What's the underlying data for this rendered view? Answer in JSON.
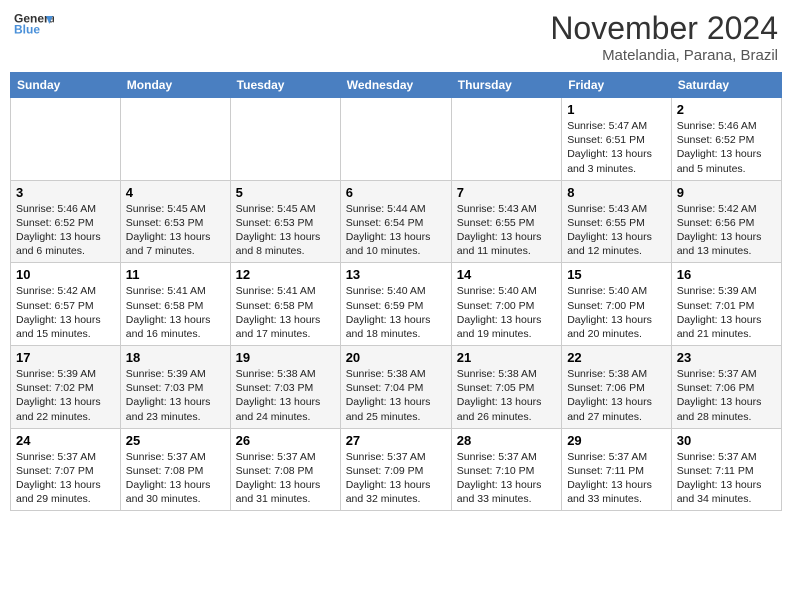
{
  "header": {
    "logo_line1": "General",
    "logo_line2": "Blue",
    "month": "November 2024",
    "location": "Matelandia, Parana, Brazil"
  },
  "weekdays": [
    "Sunday",
    "Monday",
    "Tuesday",
    "Wednesday",
    "Thursday",
    "Friday",
    "Saturday"
  ],
  "weeks": [
    [
      {
        "day": "",
        "info": ""
      },
      {
        "day": "",
        "info": ""
      },
      {
        "day": "",
        "info": ""
      },
      {
        "day": "",
        "info": ""
      },
      {
        "day": "",
        "info": ""
      },
      {
        "day": "1",
        "info": "Sunrise: 5:47 AM\nSunset: 6:51 PM\nDaylight: 13 hours and 3 minutes."
      },
      {
        "day": "2",
        "info": "Sunrise: 5:46 AM\nSunset: 6:52 PM\nDaylight: 13 hours and 5 minutes."
      }
    ],
    [
      {
        "day": "3",
        "info": "Sunrise: 5:46 AM\nSunset: 6:52 PM\nDaylight: 13 hours and 6 minutes."
      },
      {
        "day": "4",
        "info": "Sunrise: 5:45 AM\nSunset: 6:53 PM\nDaylight: 13 hours and 7 minutes."
      },
      {
        "day": "5",
        "info": "Sunrise: 5:45 AM\nSunset: 6:53 PM\nDaylight: 13 hours and 8 minutes."
      },
      {
        "day": "6",
        "info": "Sunrise: 5:44 AM\nSunset: 6:54 PM\nDaylight: 13 hours and 10 minutes."
      },
      {
        "day": "7",
        "info": "Sunrise: 5:43 AM\nSunset: 6:55 PM\nDaylight: 13 hours and 11 minutes."
      },
      {
        "day": "8",
        "info": "Sunrise: 5:43 AM\nSunset: 6:55 PM\nDaylight: 13 hours and 12 minutes."
      },
      {
        "day": "9",
        "info": "Sunrise: 5:42 AM\nSunset: 6:56 PM\nDaylight: 13 hours and 13 minutes."
      }
    ],
    [
      {
        "day": "10",
        "info": "Sunrise: 5:42 AM\nSunset: 6:57 PM\nDaylight: 13 hours and 15 minutes."
      },
      {
        "day": "11",
        "info": "Sunrise: 5:41 AM\nSunset: 6:58 PM\nDaylight: 13 hours and 16 minutes."
      },
      {
        "day": "12",
        "info": "Sunrise: 5:41 AM\nSunset: 6:58 PM\nDaylight: 13 hours and 17 minutes."
      },
      {
        "day": "13",
        "info": "Sunrise: 5:40 AM\nSunset: 6:59 PM\nDaylight: 13 hours and 18 minutes."
      },
      {
        "day": "14",
        "info": "Sunrise: 5:40 AM\nSunset: 7:00 PM\nDaylight: 13 hours and 19 minutes."
      },
      {
        "day": "15",
        "info": "Sunrise: 5:40 AM\nSunset: 7:00 PM\nDaylight: 13 hours and 20 minutes."
      },
      {
        "day": "16",
        "info": "Sunrise: 5:39 AM\nSunset: 7:01 PM\nDaylight: 13 hours and 21 minutes."
      }
    ],
    [
      {
        "day": "17",
        "info": "Sunrise: 5:39 AM\nSunset: 7:02 PM\nDaylight: 13 hours and 22 minutes."
      },
      {
        "day": "18",
        "info": "Sunrise: 5:39 AM\nSunset: 7:03 PM\nDaylight: 13 hours and 23 minutes."
      },
      {
        "day": "19",
        "info": "Sunrise: 5:38 AM\nSunset: 7:03 PM\nDaylight: 13 hours and 24 minutes."
      },
      {
        "day": "20",
        "info": "Sunrise: 5:38 AM\nSunset: 7:04 PM\nDaylight: 13 hours and 25 minutes."
      },
      {
        "day": "21",
        "info": "Sunrise: 5:38 AM\nSunset: 7:05 PM\nDaylight: 13 hours and 26 minutes."
      },
      {
        "day": "22",
        "info": "Sunrise: 5:38 AM\nSunset: 7:06 PM\nDaylight: 13 hours and 27 minutes."
      },
      {
        "day": "23",
        "info": "Sunrise: 5:37 AM\nSunset: 7:06 PM\nDaylight: 13 hours and 28 minutes."
      }
    ],
    [
      {
        "day": "24",
        "info": "Sunrise: 5:37 AM\nSunset: 7:07 PM\nDaylight: 13 hours and 29 minutes."
      },
      {
        "day": "25",
        "info": "Sunrise: 5:37 AM\nSunset: 7:08 PM\nDaylight: 13 hours and 30 minutes."
      },
      {
        "day": "26",
        "info": "Sunrise: 5:37 AM\nSunset: 7:08 PM\nDaylight: 13 hours and 31 minutes."
      },
      {
        "day": "27",
        "info": "Sunrise: 5:37 AM\nSunset: 7:09 PM\nDaylight: 13 hours and 32 minutes."
      },
      {
        "day": "28",
        "info": "Sunrise: 5:37 AM\nSunset: 7:10 PM\nDaylight: 13 hours and 33 minutes."
      },
      {
        "day": "29",
        "info": "Sunrise: 5:37 AM\nSunset: 7:11 PM\nDaylight: 13 hours and 33 minutes."
      },
      {
        "day": "30",
        "info": "Sunrise: 5:37 AM\nSunset: 7:11 PM\nDaylight: 13 hours and 34 minutes."
      }
    ]
  ]
}
